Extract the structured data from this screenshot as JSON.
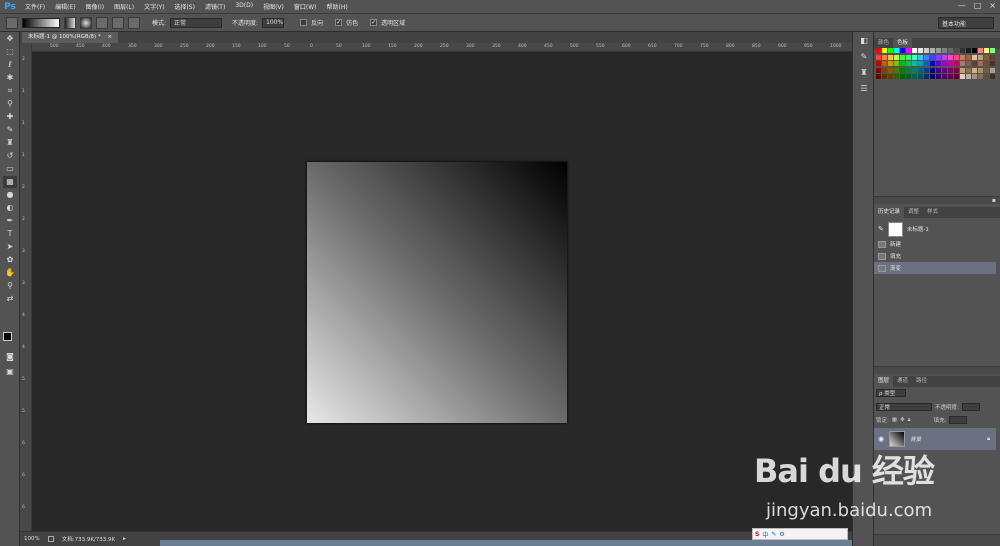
{
  "app": {
    "logo": "Ps"
  },
  "menu": [
    "文件(F)",
    "编辑(E)",
    "图像(I)",
    "图层(L)",
    "文字(Y)",
    "选择(S)",
    "滤镜(T)",
    "3D(D)",
    "视图(V)",
    "窗口(W)",
    "帮助(H)"
  ],
  "window_controls": {
    "minimize": "—",
    "maximize": "□",
    "close": "×"
  },
  "options": {
    "mode_label": "模式:",
    "mode_value": "正常",
    "opacity_label": "不透明度:",
    "opacity_value": "100%",
    "reverse_label": "反向",
    "dither_label": "仿色",
    "transparency_label": "透明区域",
    "workspace": "基本功能"
  },
  "document": {
    "tab_title": "未标题-1 @ 100%(RGB/8) *",
    "zoom": "100%",
    "doc_size": "文档:733.9K/733.9K"
  },
  "ruler": {
    "h_labels": [
      "500",
      "450",
      "400",
      "350",
      "300",
      "250",
      "200",
      "150",
      "100",
      "50",
      "0",
      "50",
      "100",
      "150",
      "200",
      "250",
      "300",
      "350",
      "400",
      "450",
      "500",
      "550",
      "600",
      "650",
      "700",
      "750",
      "800",
      "850",
      "900",
      "950",
      "1000"
    ],
    "v_labels": [
      "2",
      "1",
      "1",
      "1",
      "2",
      "2",
      "3",
      "3",
      "4",
      "4",
      "5",
      "5",
      "6",
      "6",
      "6"
    ]
  },
  "panels": {
    "top_tabs": [
      "颜色",
      "色板"
    ],
    "mid_tabs": [
      "历史记录",
      "调整",
      "样式"
    ],
    "bottom_tabs": [
      "图层",
      "通道",
      "路径"
    ],
    "history_snapshot": "未标题-1",
    "history_items": [
      "新建",
      "填充",
      "渐变"
    ],
    "layers": {
      "filter_label": "ρ 类型",
      "blend_mode": "正常",
      "opacity_label": "不透明度:",
      "lock_label": "锁定:",
      "fill_label": "填充:",
      "layer_name": "背景"
    }
  },
  "swatch_colors": [
    "#ff0000",
    "#ffff00",
    "#00ff00",
    "#00ffff",
    "#0000ff",
    "#ff00ff",
    "#ffffff",
    "#e6e6e6",
    "#cccccc",
    "#b3b3b3",
    "#999999",
    "#808080",
    "#666666",
    "#4d4d4d",
    "#333333",
    "#1a1a1a",
    "#000000",
    "#ff8080",
    "#ffff80",
    "#80ff80",
    "#ff4040",
    "#ff8040",
    "#ffc040",
    "#c0ff40",
    "#40ff40",
    "#40ff80",
    "#40ffc0",
    "#40c0ff",
    "#4080ff",
    "#4040ff",
    "#8040ff",
    "#c040ff",
    "#ff40c0",
    "#ff4080",
    "#c08060",
    "#a06040",
    "#e0c0a0",
    "#c0a080",
    "#806040",
    "#604020",
    "#c00000",
    "#c06000",
    "#c0a000",
    "#80c000",
    "#00c000",
    "#00c060",
    "#00c0a0",
    "#00a0c0",
    "#0060c0",
    "#0000c0",
    "#6000c0",
    "#a000c0",
    "#c000a0",
    "#c00060",
    "#a08060",
    "#806050",
    "#604030",
    "#a07050",
    "#705030",
    "#503020",
    "#800000",
    "#804000",
    "#806000",
    "#408000",
    "#008000",
    "#008040",
    "#008060",
    "#006080",
    "#004080",
    "#000080",
    "#400080",
    "#600080",
    "#800060",
    "#800040",
    "#c0a070",
    "#907050",
    "#d0b080",
    "#b09060",
    "#706040",
    "#a0a0a0",
    "#600000",
    "#603000",
    "#604000",
    "#306000",
    "#006000",
    "#006030",
    "#006050",
    "#005060",
    "#003060",
    "#000060",
    "#300060",
    "#500060",
    "#600050",
    "#600030",
    "#e0d0c0",
    "#c0b0a0",
    "#a09080",
    "#807060",
    "#605040",
    "#403020"
  ],
  "watermark": {
    "main": "Bai du 经验",
    "sub": "jingyan.baidu.com"
  },
  "ime": {
    "label": "中"
  }
}
